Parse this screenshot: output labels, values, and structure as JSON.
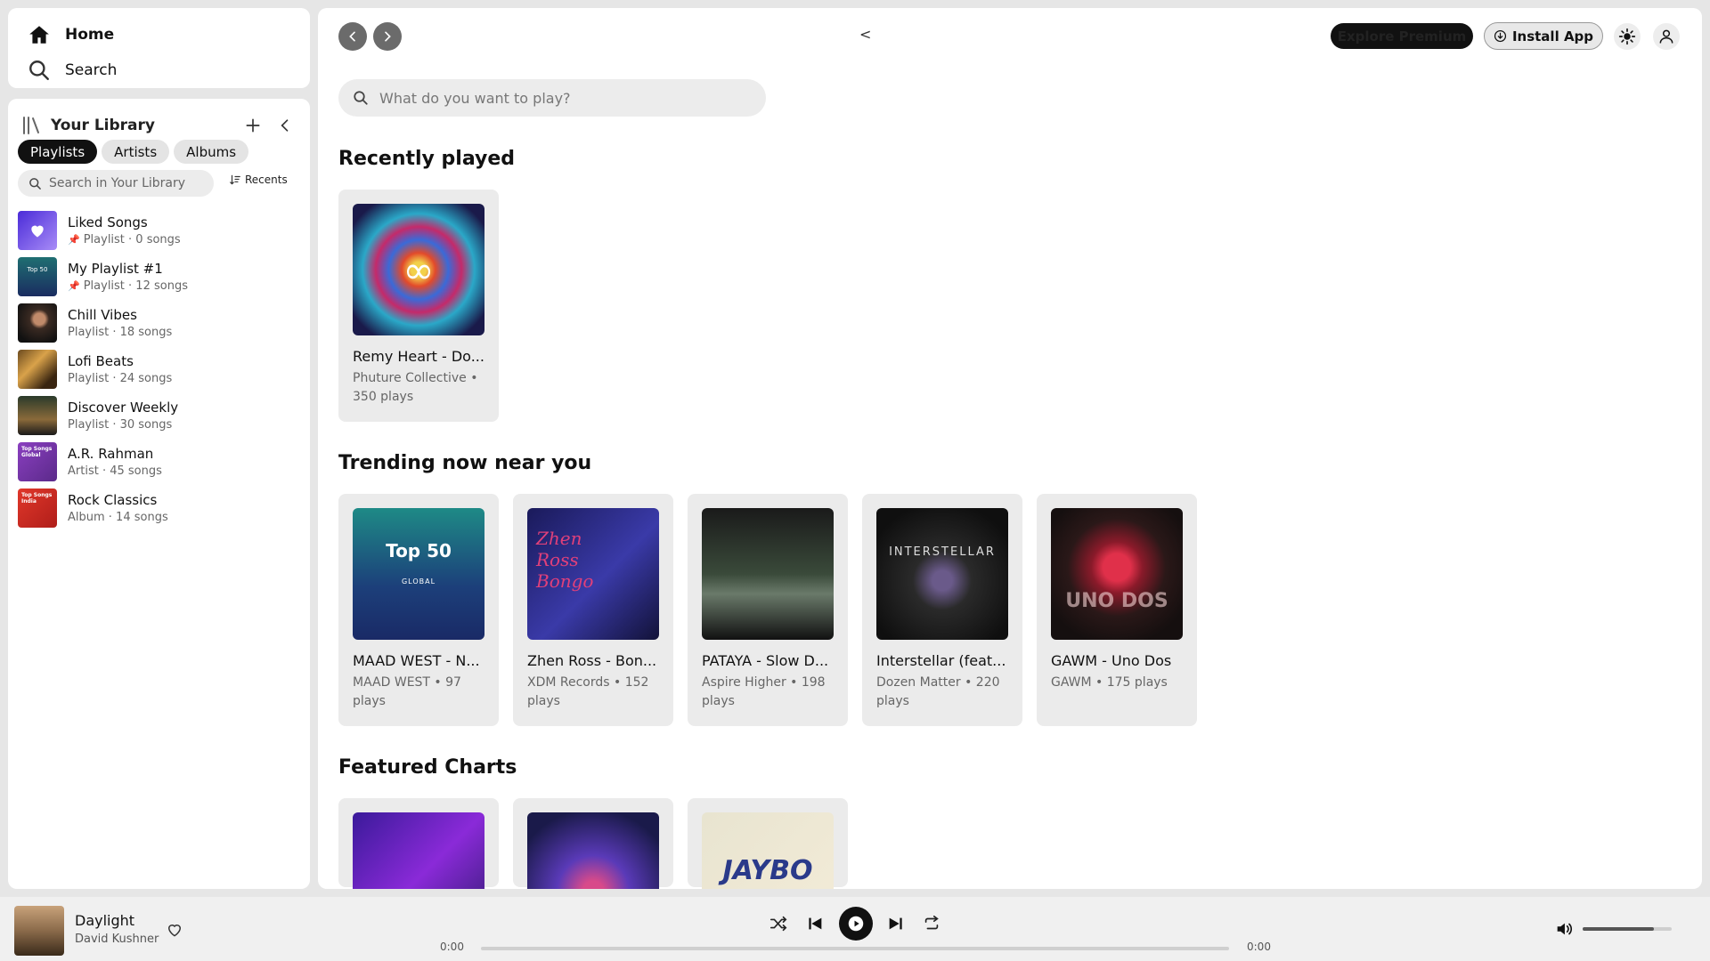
{
  "nav": {
    "home_label": "Home",
    "search_label": "Search"
  },
  "library": {
    "title": "Your Library",
    "filters": [
      "Playlists",
      "Artists",
      "Albums"
    ],
    "active_filter": "Playlists",
    "search_placeholder": "Search in Your Library",
    "sort_label": "Recents",
    "items": [
      {
        "name": "Liked Songs",
        "meta": "Playlist · 0 songs",
        "pinned": true
      },
      {
        "name": "My Playlist #1",
        "meta": "Playlist · 12 songs",
        "pinned": true,
        "thumb_text": "Top 50"
      },
      {
        "name": "Chill Vibes",
        "meta": "Playlist · 18 songs",
        "pinned": false
      },
      {
        "name": "Lofi Beats",
        "meta": "Playlist · 24 songs",
        "pinned": false
      },
      {
        "name": "Discover Weekly",
        "meta": "Playlist · 30 songs",
        "pinned": false
      },
      {
        "name": "A.R. Rahman",
        "meta": "Artist · 45 songs",
        "pinned": false,
        "thumb_text": "Top Songs Global"
      },
      {
        "name": "Rock Classics",
        "meta": "Album · 14 songs",
        "pinned": false,
        "thumb_text": "Top Songs India"
      }
    ]
  },
  "topbar": {
    "back_chevron": "<",
    "premium_label": "Explore Premium",
    "install_label": "Install App"
  },
  "main_search": {
    "placeholder": "What do you want to play?"
  },
  "sections": {
    "recent": {
      "title": "Recently played",
      "cards": [
        {
          "title": "Remy Heart - Do...",
          "sub": "Phuture Collective • 350 plays"
        }
      ]
    },
    "trending": {
      "title": "Trending now near you",
      "cards": [
        {
          "title": "MAAD WEST - N...",
          "sub": "MAAD WEST • 97 plays",
          "art_text": "Top 50",
          "art_sub": "GLOBAL"
        },
        {
          "title": "Zhen Ross - Bon...",
          "sub": "XDM Records • 152 plays",
          "art_text": "Zhen Ross Bongo"
        },
        {
          "title": "PATAYA - Slow D...",
          "sub": "Aspire Higher • 198 plays"
        },
        {
          "title": "Interstellar (feat...",
          "sub": "Dozen Matter • 220 plays",
          "art_text": "INTERSTELLAR"
        },
        {
          "title": "GAWM - Uno Dos",
          "sub": "GAWM • 175 plays",
          "art_text": "UNO DOS"
        }
      ]
    },
    "charts": {
      "title": "Featured Charts",
      "art_text_3": "JAYBO"
    }
  },
  "player": {
    "title": "Daylight",
    "artist": "David Kushner",
    "elapsed": "0:00",
    "duration": "0:00",
    "progress": 0,
    "volume": 0.8
  }
}
